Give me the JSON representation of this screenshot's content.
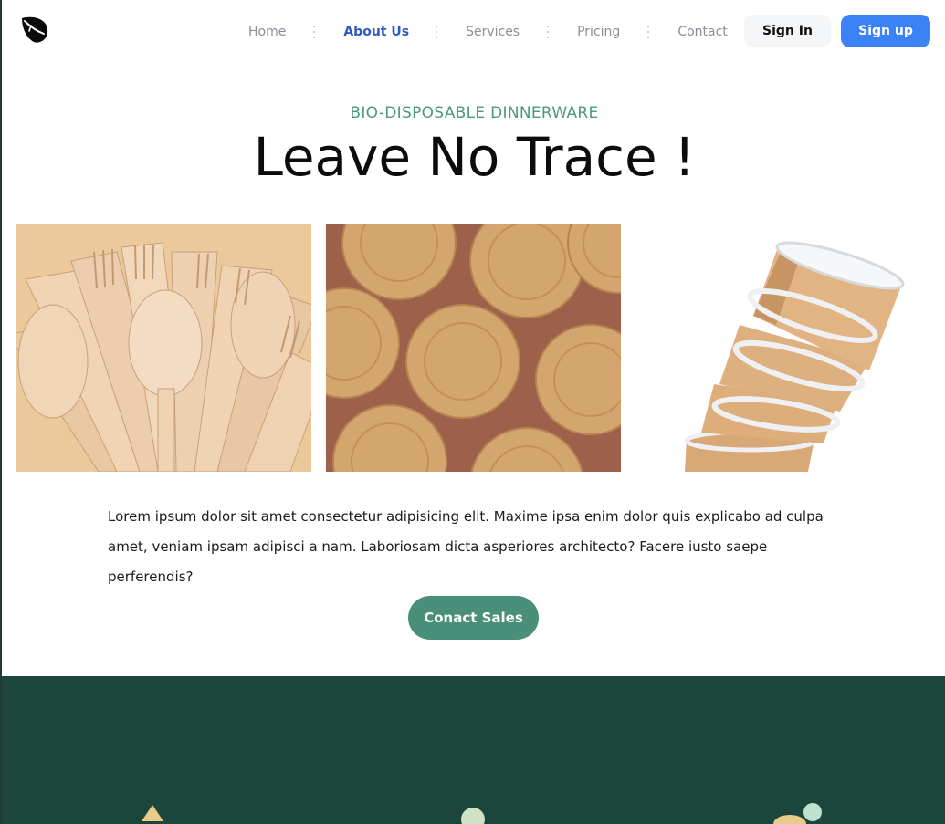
{
  "nav": {
    "links": [
      {
        "label": "Home",
        "active": false
      },
      {
        "label": "About Us",
        "active": true
      },
      {
        "label": "Services",
        "active": false
      },
      {
        "label": "Pricing",
        "active": false
      },
      {
        "label": "Contact",
        "active": false
      }
    ],
    "sign_in": "Sign In",
    "sign_up": "Sign up"
  },
  "hero": {
    "eyebrow": "BIO-DISPOSABLE DINNERWARE",
    "title": "Leave No Trace !",
    "images": [
      {
        "name": "wooden-cutlery-image"
      },
      {
        "name": "paper-plates-image"
      },
      {
        "name": "paper-cups-image"
      }
    ],
    "description": "Lorem ipsum dolor sit amet consectetur adipisicing elit. Maxime ipsa enim dolor quis explicabo ad culpa amet, veniam ipsam adipisci a nam. Laboriosam dicta asperiores architecto? Facere iusto saepe perferendis?",
    "cta": "Conact Sales"
  },
  "colors": {
    "accent": "#4a8f7a",
    "eyebrow": "#4c9a7e",
    "active_link": "#2f57c8",
    "sign_up_bg": "#3b82f6",
    "footer_band": "#1c463c"
  },
  "icons": {
    "logo": "leaf-logo-icon"
  }
}
